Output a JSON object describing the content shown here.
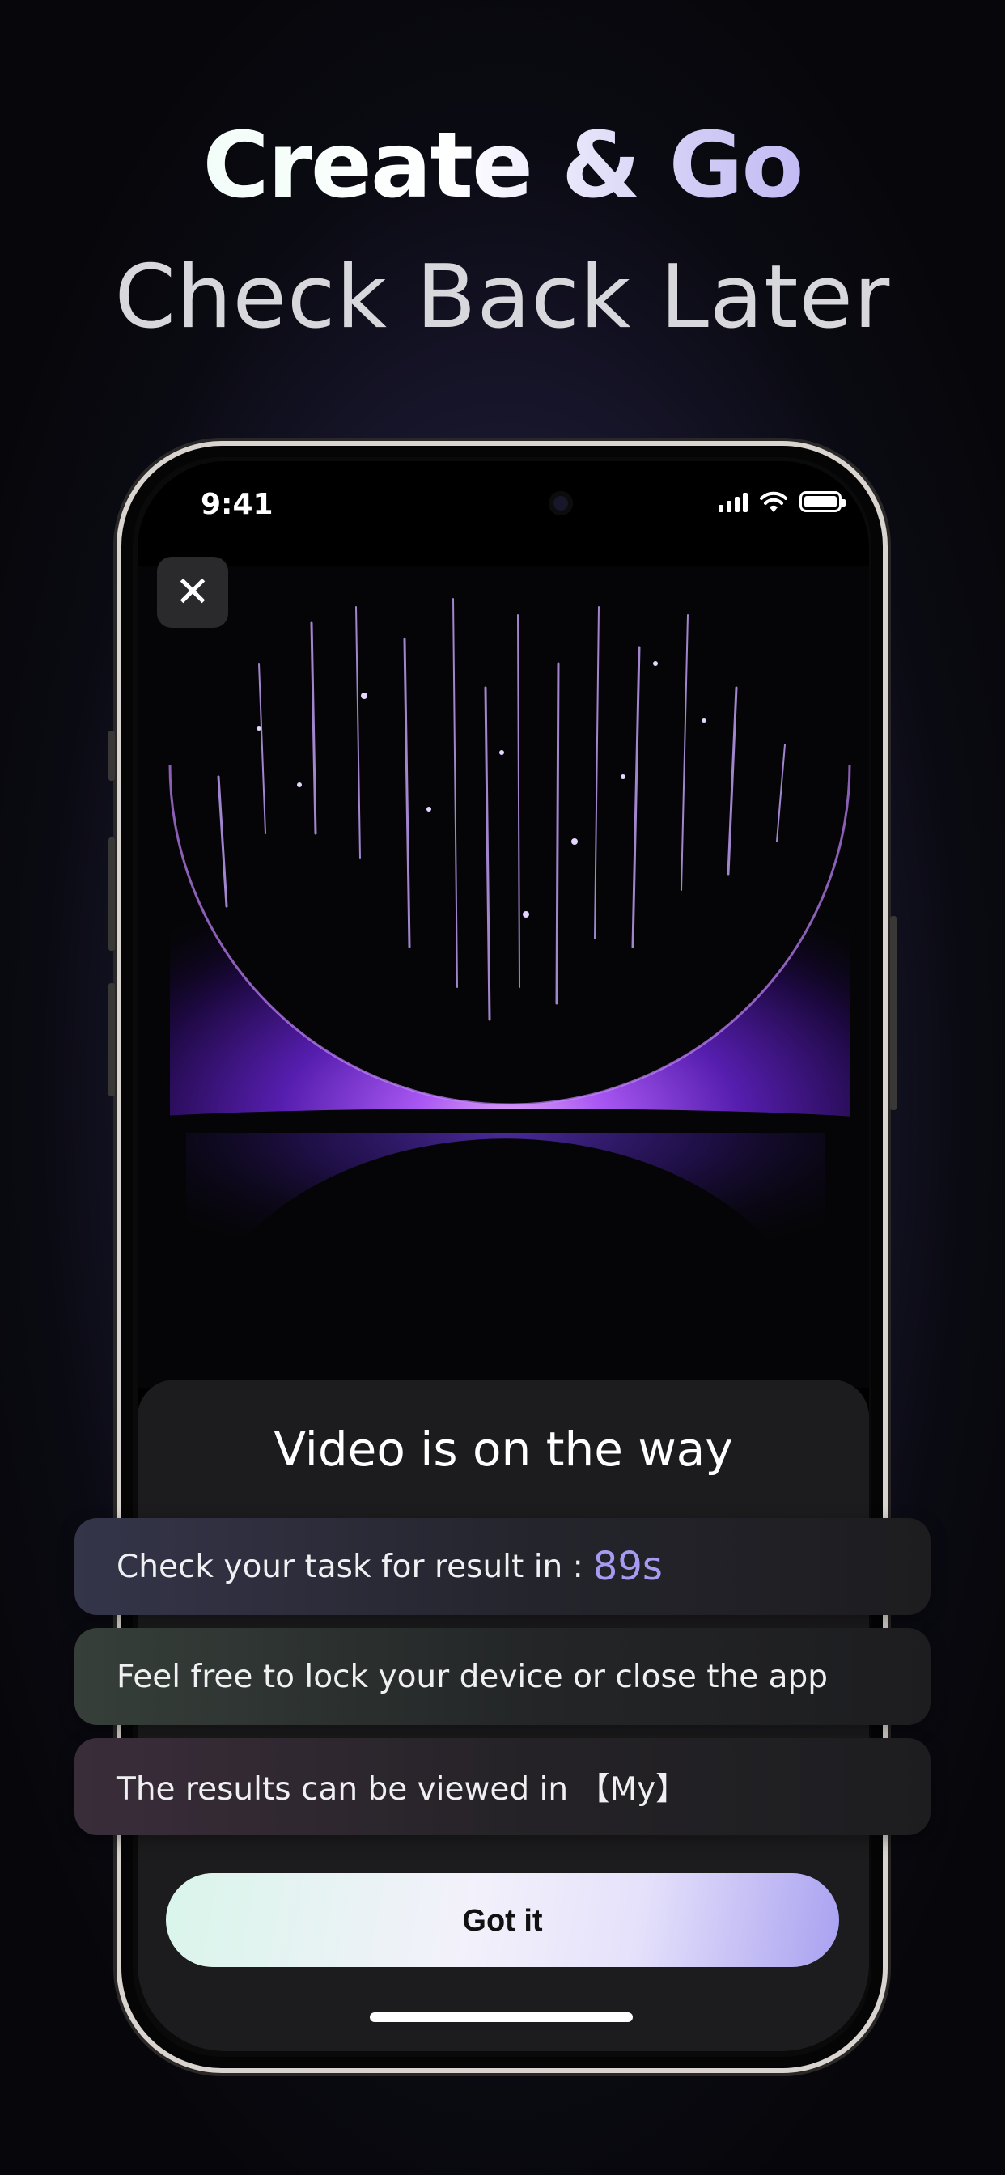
{
  "headline": {
    "line1": "Create & Go",
    "line2": "Check Back Later"
  },
  "status_bar": {
    "time": "9:41",
    "icons": [
      "cellular-signal-icon",
      "wifi-icon",
      "battery-icon"
    ]
  },
  "sheet": {
    "title": "Video is on the way",
    "cards": [
      {
        "text": "Check your task for result in :",
        "countdown": "89s"
      },
      {
        "text": "Feel free to lock your device or close the app"
      },
      {
        "text": "The results can be viewed in 【My】"
      }
    ],
    "button_label": "Got it"
  },
  "colors": {
    "accent": "#a59cf2",
    "glow": "#8a4cff",
    "sheet_bg": "#1c1c1e"
  }
}
